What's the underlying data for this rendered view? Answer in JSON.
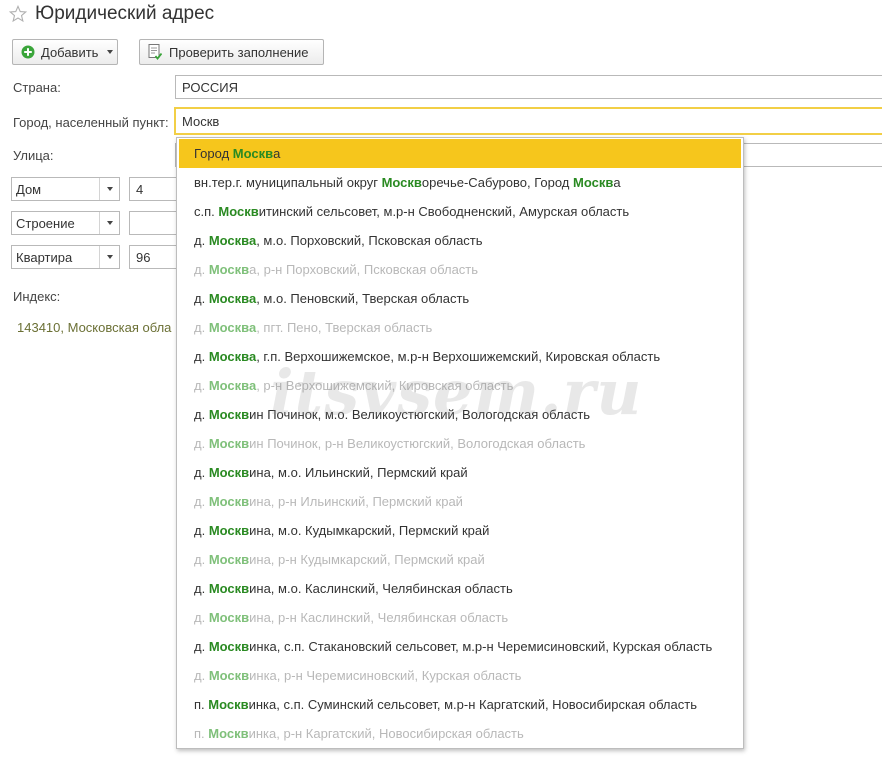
{
  "header": {
    "title": "Юридический адрес",
    "star_icon": "star-icon"
  },
  "toolbar": {
    "add_label": "Добавить",
    "check_label": "Проверить заполнение"
  },
  "form": {
    "country": {
      "label": "Страна:",
      "value": "РОССИЯ"
    },
    "city": {
      "label": "Город, населенный пункт:",
      "value": "Москв"
    },
    "street": {
      "label": "Улица:",
      "value": ""
    },
    "house": {
      "type": "Дом",
      "value": "4"
    },
    "building": {
      "type": "Строение",
      "value": ""
    },
    "apartment": {
      "type": "Квартира",
      "value": "96"
    },
    "index": {
      "label": "Индекс:"
    },
    "full_address": "143410, Московская обла"
  },
  "dropdown": {
    "items": [
      {
        "parts": [
          [
            "Город ",
            false
          ],
          [
            "Москв",
            true
          ],
          [
            "а",
            false
          ]
        ],
        "state": "selected"
      },
      {
        "parts": [
          [
            "вн.тер.г. муниципальный округ ",
            false
          ],
          [
            "Москв",
            true
          ],
          [
            "оречье-Сабурово, Город ",
            false
          ],
          [
            "Москв",
            true
          ],
          [
            "а",
            false
          ]
        ],
        "state": "normal"
      },
      {
        "parts": [
          [
            "с.п. ",
            false
          ],
          [
            "Москв",
            true
          ],
          [
            "итинский сельсовет, м.р-н Свободненский, Амурская область",
            false
          ]
        ],
        "state": "normal"
      },
      {
        "parts": [
          [
            "д. ",
            false
          ],
          [
            "Москва",
            true
          ],
          [
            ", м.о. Порховский, Псковская область",
            false
          ]
        ],
        "state": "normal"
      },
      {
        "parts": [
          [
            "д. ",
            false
          ],
          [
            "Москв",
            true
          ],
          [
            "а, р-н Порховский, Псковская область",
            false
          ]
        ],
        "state": "dim"
      },
      {
        "parts": [
          [
            "д. ",
            false
          ],
          [
            "Москва",
            true
          ],
          [
            ", м.о. Пеновский, Тверская область",
            false
          ]
        ],
        "state": "normal"
      },
      {
        "parts": [
          [
            "д. ",
            false
          ],
          [
            "Москва",
            true
          ],
          [
            ", пгт. Пено, Тверская область",
            false
          ]
        ],
        "state": "dim"
      },
      {
        "parts": [
          [
            "д. ",
            false
          ],
          [
            "Москва",
            true
          ],
          [
            ", г.п. Верхошижемское, м.р-н Верхошижемский, Кировская область",
            false
          ]
        ],
        "state": "normal"
      },
      {
        "parts": [
          [
            "д. ",
            false
          ],
          [
            "Москва",
            true
          ],
          [
            ", р-н Верхошижемский, Кировская область",
            false
          ]
        ],
        "state": "dim"
      },
      {
        "parts": [
          [
            "д. ",
            false
          ],
          [
            "Москв",
            true
          ],
          [
            "ин Починок, м.о. Великоустюгский, Вологодская область",
            false
          ]
        ],
        "state": "normal"
      },
      {
        "parts": [
          [
            "д. ",
            false
          ],
          [
            "Москв",
            true
          ],
          [
            "ин Починок, р-н Великоустюгский, Вологодская область",
            false
          ]
        ],
        "state": "dim"
      },
      {
        "parts": [
          [
            "д. ",
            false
          ],
          [
            "Москв",
            true
          ],
          [
            "ина, м.о. Ильинский, Пермский край",
            false
          ]
        ],
        "state": "normal"
      },
      {
        "parts": [
          [
            "д. ",
            false
          ],
          [
            "Москв",
            true
          ],
          [
            "ина, р-н Ильинский, Пермский край",
            false
          ]
        ],
        "state": "dim"
      },
      {
        "parts": [
          [
            "д. ",
            false
          ],
          [
            "Москв",
            true
          ],
          [
            "ина, м.о. Кудымкарский, Пермский край",
            false
          ]
        ],
        "state": "normal"
      },
      {
        "parts": [
          [
            "д. ",
            false
          ],
          [
            "Москв",
            true
          ],
          [
            "ина, р-н Кудымкарский, Пермский край",
            false
          ]
        ],
        "state": "dim"
      },
      {
        "parts": [
          [
            "д. ",
            false
          ],
          [
            "Москв",
            true
          ],
          [
            "ина, м.о. Каслинский, Челябинская область",
            false
          ]
        ],
        "state": "normal"
      },
      {
        "parts": [
          [
            "д. ",
            false
          ],
          [
            "Москв",
            true
          ],
          [
            "ина, р-н Каслинский, Челябинская область",
            false
          ]
        ],
        "state": "dim"
      },
      {
        "parts": [
          [
            "д. ",
            false
          ],
          [
            "Москв",
            true
          ],
          [
            "инка, с.п. Стакановский сельсовет, м.р-н Черемисиновский, Курская область",
            false
          ]
        ],
        "state": "normal"
      },
      {
        "parts": [
          [
            "д. ",
            false
          ],
          [
            "Москв",
            true
          ],
          [
            "инка, р-н Черемисиновский, Курская область",
            false
          ]
        ],
        "state": "dim"
      },
      {
        "parts": [
          [
            "п. ",
            false
          ],
          [
            "Москв",
            true
          ],
          [
            "инка, с.п. Суминский сельсовет, м.р-н Каргатский, Новосибирская область",
            false
          ]
        ],
        "state": "normal"
      },
      {
        "parts": [
          [
            "п. ",
            false
          ],
          [
            "Москв",
            true
          ],
          [
            "инка, р-н Каргатский, Новосибирская область",
            false
          ]
        ],
        "state": "dim"
      }
    ]
  },
  "watermark": "itsvsem.ru",
  "colors": {
    "accent_yellow": "#f6c61c",
    "focus_border": "#f2cf46",
    "match_green": "#2a8a22",
    "dim_text": "#b8b8b8",
    "address_text": "#6b7035"
  }
}
